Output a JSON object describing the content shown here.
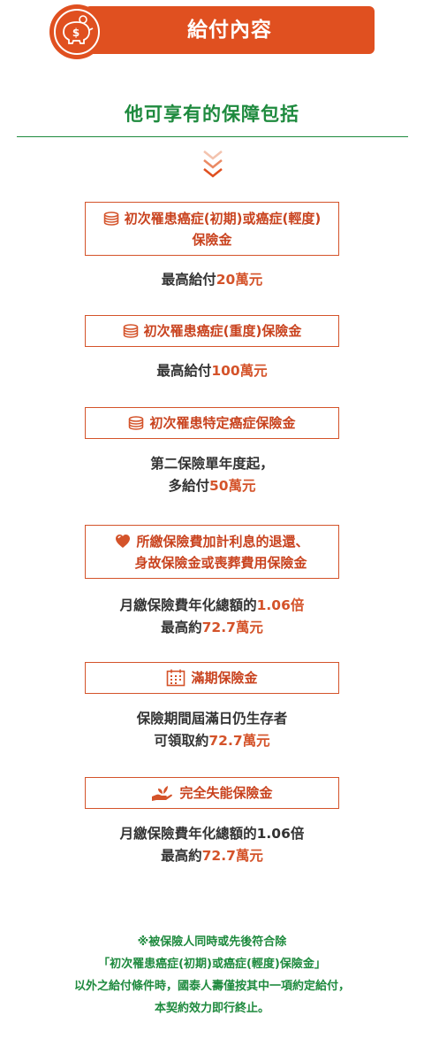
{
  "header": {
    "title": "給付內容",
    "icon": "piggy-bank-icon",
    "color": "#e05020"
  },
  "subtitle": "他可享有的保障包括",
  "accent_green": "#1e8a3e",
  "benefits": [
    {
      "icon": "coin-stack-icon",
      "title_line1": "初次罹患癌症(初期)或癌症(輕度)",
      "title_line2": "保險金",
      "desc_line1_prefix": "最高給付",
      "desc_line1_value": "20萬元"
    },
    {
      "icon": "coin-stack-icon",
      "title_line1": "初次罹患癌症(重度)保險金",
      "desc_line1_prefix": "最高給付",
      "desc_line1_value": "100萬元"
    },
    {
      "icon": "coin-stack-icon",
      "title_line1": "初次罹患特定癌症保險金",
      "desc_line1_prefix": "第二保險單年度起，",
      "desc_line2_prefix": "多給付",
      "desc_line2_value": "50萬元"
    },
    {
      "icon": "heart-icon",
      "title_line1": "所繳保險費加計利息的退還、",
      "title_line2": "身故保險金或喪葬費用保險金",
      "desc_line1_prefix": "月繳保險費年化總額的",
      "desc_line1_value": "1.06倍",
      "desc_line2_prefix": "最高約",
      "desc_line2_value": "72.7萬元"
    },
    {
      "icon": "calendar-icon",
      "title_line1": "滿期保險金",
      "desc_line1_prefix": "保險期間屆滿日仍生存者",
      "desc_line2_prefix": "可領取約",
      "desc_line2_value": "72.7萬元"
    },
    {
      "icon": "hand-sprout-icon",
      "title_line1": "完全失能保險金",
      "desc_line1_prefix": "月繳保險費年化總額的1.06倍",
      "desc_line2_prefix": "最高約",
      "desc_line2_value": "72.7萬元"
    }
  ],
  "footnote": {
    "line1": "※被保險人同時或先後符合除",
    "line2": "「初次罹患癌症(初期)或癌症(輕度)保險金」",
    "line3": "以外之給付條件時，國泰人壽僅按其中一項約定給付，",
    "line4": "本契約效力即行終止。"
  }
}
